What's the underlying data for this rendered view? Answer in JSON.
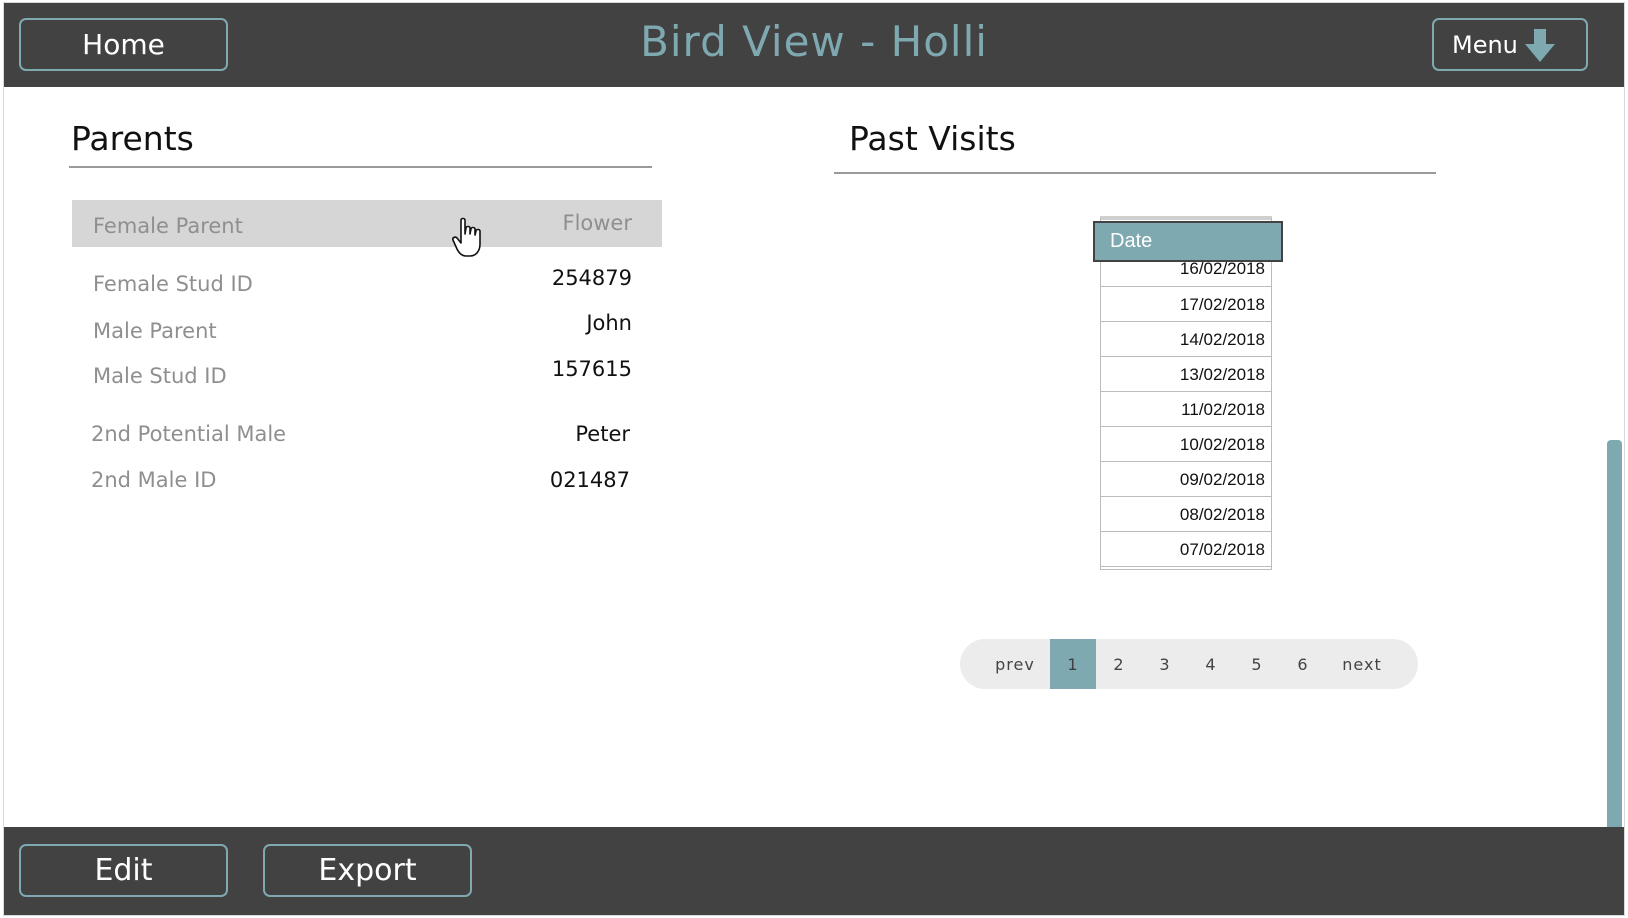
{
  "header": {
    "title": "Bird View - Holli",
    "home_label": "Home",
    "menu_label": "Menu",
    "menu_icon": "down-arrow-icon"
  },
  "parents": {
    "section_title": "Parents",
    "rows": [
      {
        "label": "Female Parent",
        "value": "Flower"
      },
      {
        "label": "Female Stud ID",
        "value": "254879"
      },
      {
        "label": "Male Parent",
        "value": "John"
      },
      {
        "label": "Male Stud ID",
        "value": "157615"
      },
      {
        "label": "2nd Potential Male",
        "value": "Peter"
      },
      {
        "label": "2nd Male ID",
        "value": "021487"
      }
    ]
  },
  "past_visits": {
    "section_title": "Past Visits",
    "column_header": "Date",
    "dates": [
      "16/02/2018",
      "17/02/2018",
      "14/02/2018",
      "13/02/2018",
      "11/02/2018",
      "10/02/2018",
      "09/02/2018",
      "08/02/2018",
      "07/02/2018"
    ],
    "pagination": {
      "prev_label": "prev",
      "next_label": "next",
      "pages": [
        "1",
        "2",
        "3",
        "4",
        "5",
        "6"
      ],
      "current_page": "1"
    }
  },
  "footer": {
    "edit_label": "Edit",
    "export_label": "Export"
  },
  "colors": {
    "accent": "#7ea9b1",
    "bar": "#424242",
    "highlight_row": "#d6d6d6"
  }
}
